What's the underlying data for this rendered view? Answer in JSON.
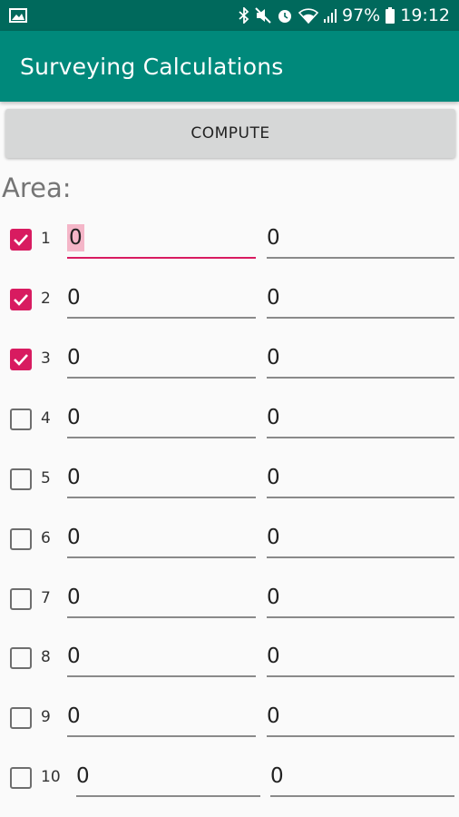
{
  "status_bar": {
    "battery": "97%",
    "time": "19:12",
    "icons": [
      "image-icon",
      "bluetooth-icon",
      "mute-icon",
      "alarm-icon",
      "wifi-icon",
      "signal-icon",
      "battery-icon"
    ]
  },
  "app_bar": {
    "title": "Surveying Calculations"
  },
  "compute_button": {
    "label": "COMPUTE"
  },
  "area_label": "Area:",
  "rows": [
    {
      "num": "1",
      "checked": true,
      "x": "0",
      "y": "0"
    },
    {
      "num": "2",
      "checked": true,
      "x": "0",
      "y": "0"
    },
    {
      "num": "3",
      "checked": true,
      "x": "0",
      "y": "0"
    },
    {
      "num": "4",
      "checked": false,
      "x": "0",
      "y": "0"
    },
    {
      "num": "5",
      "checked": false,
      "x": "0",
      "y": "0"
    },
    {
      "num": "6",
      "checked": false,
      "x": "0",
      "y": "0"
    },
    {
      "num": "7",
      "checked": false,
      "x": "0",
      "y": "0"
    },
    {
      "num": "8",
      "checked": false,
      "x": "0",
      "y": "0"
    },
    {
      "num": "9",
      "checked": false,
      "x": "0",
      "y": "0"
    },
    {
      "num": "10",
      "checked": false,
      "x": "0",
      "y": "0"
    }
  ],
  "colors": {
    "status_bar": "#00695c",
    "app_bar": "#00897b",
    "accent": "#d81b60"
  }
}
